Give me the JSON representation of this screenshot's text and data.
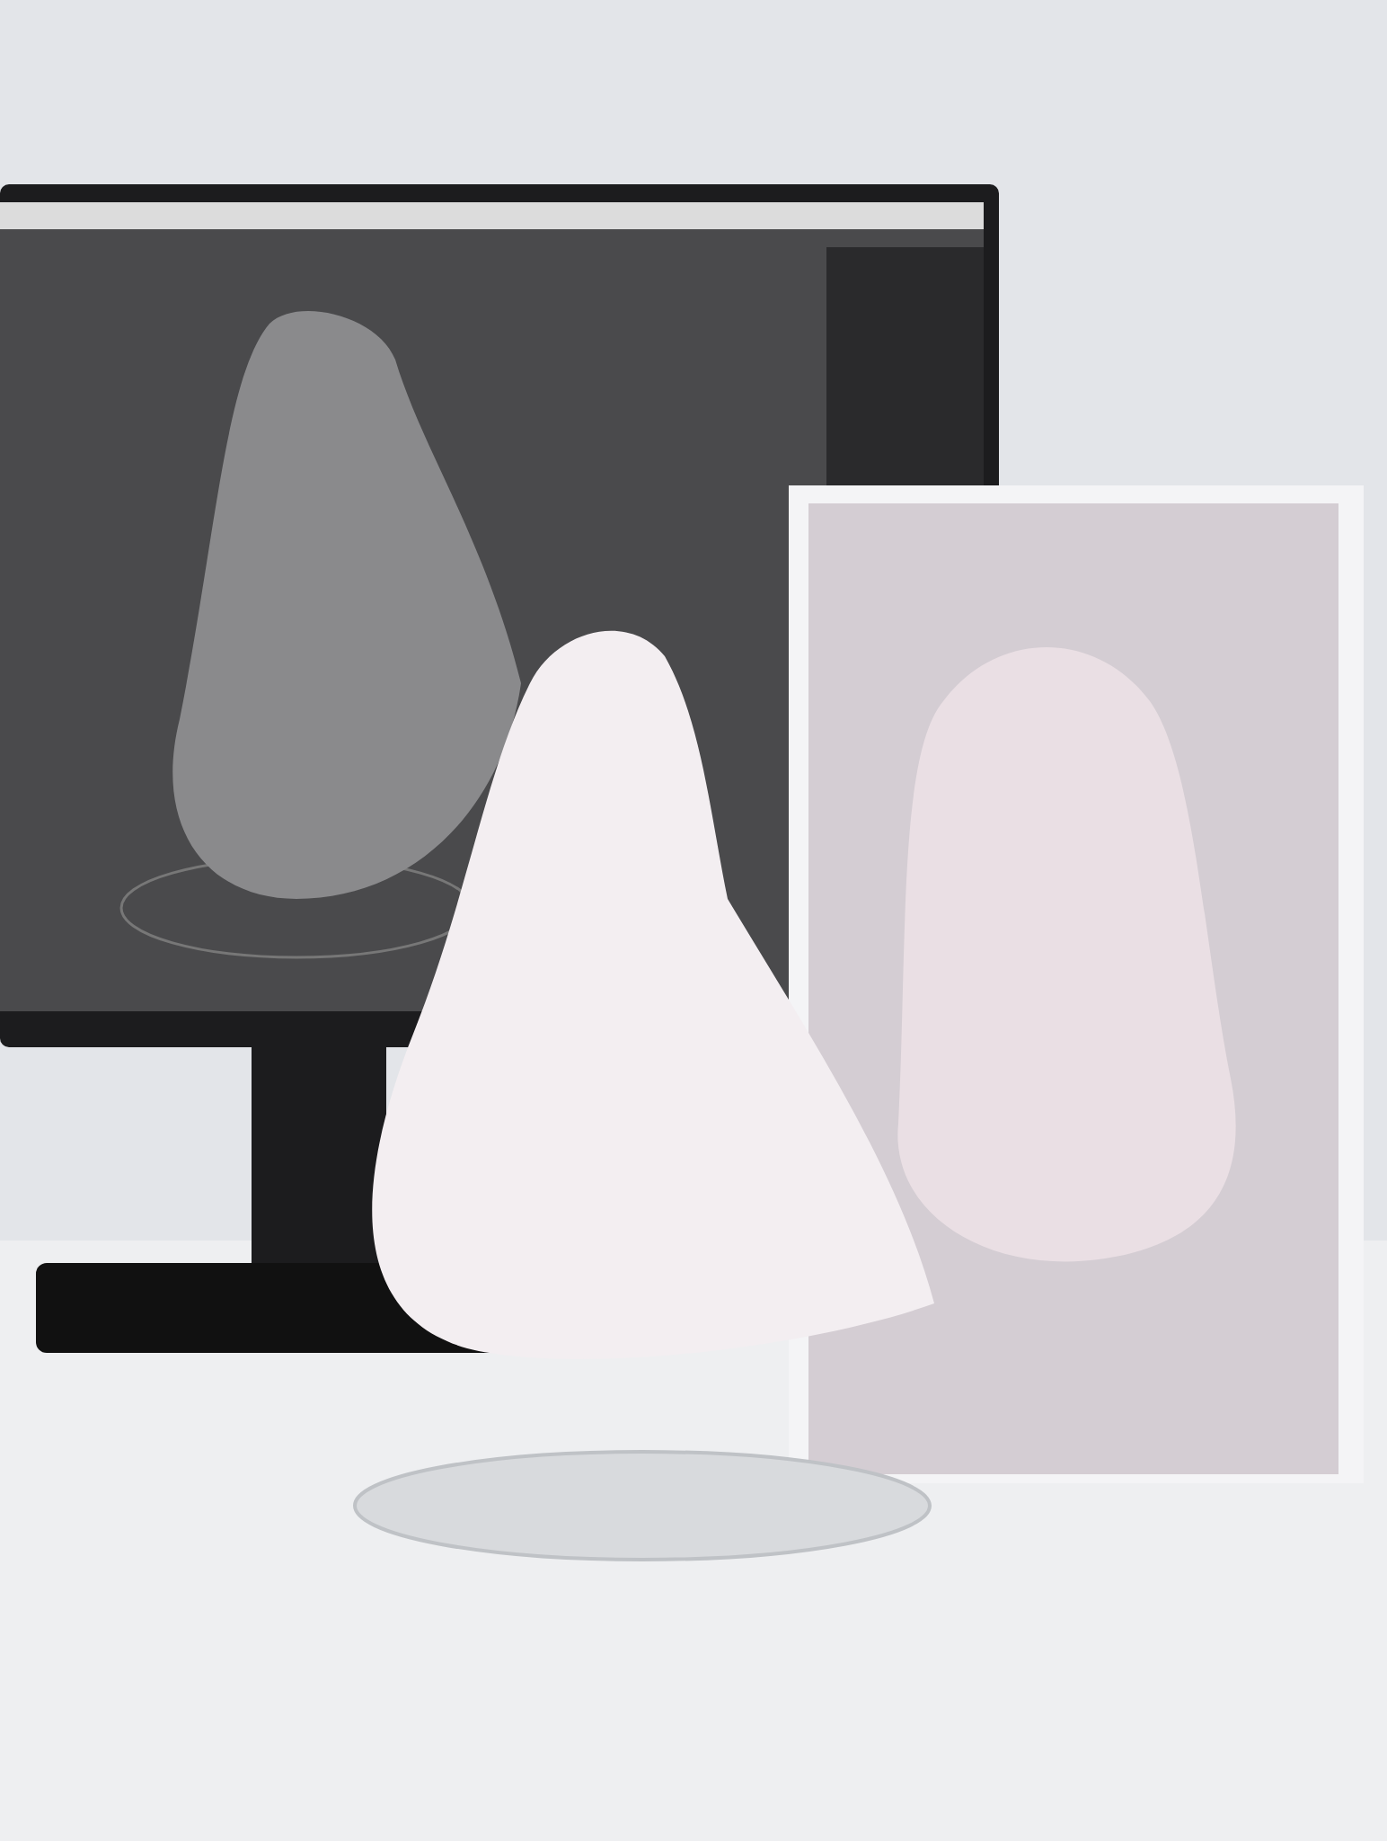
{
  "scene": {
    "kind": "photo"
  }
}
